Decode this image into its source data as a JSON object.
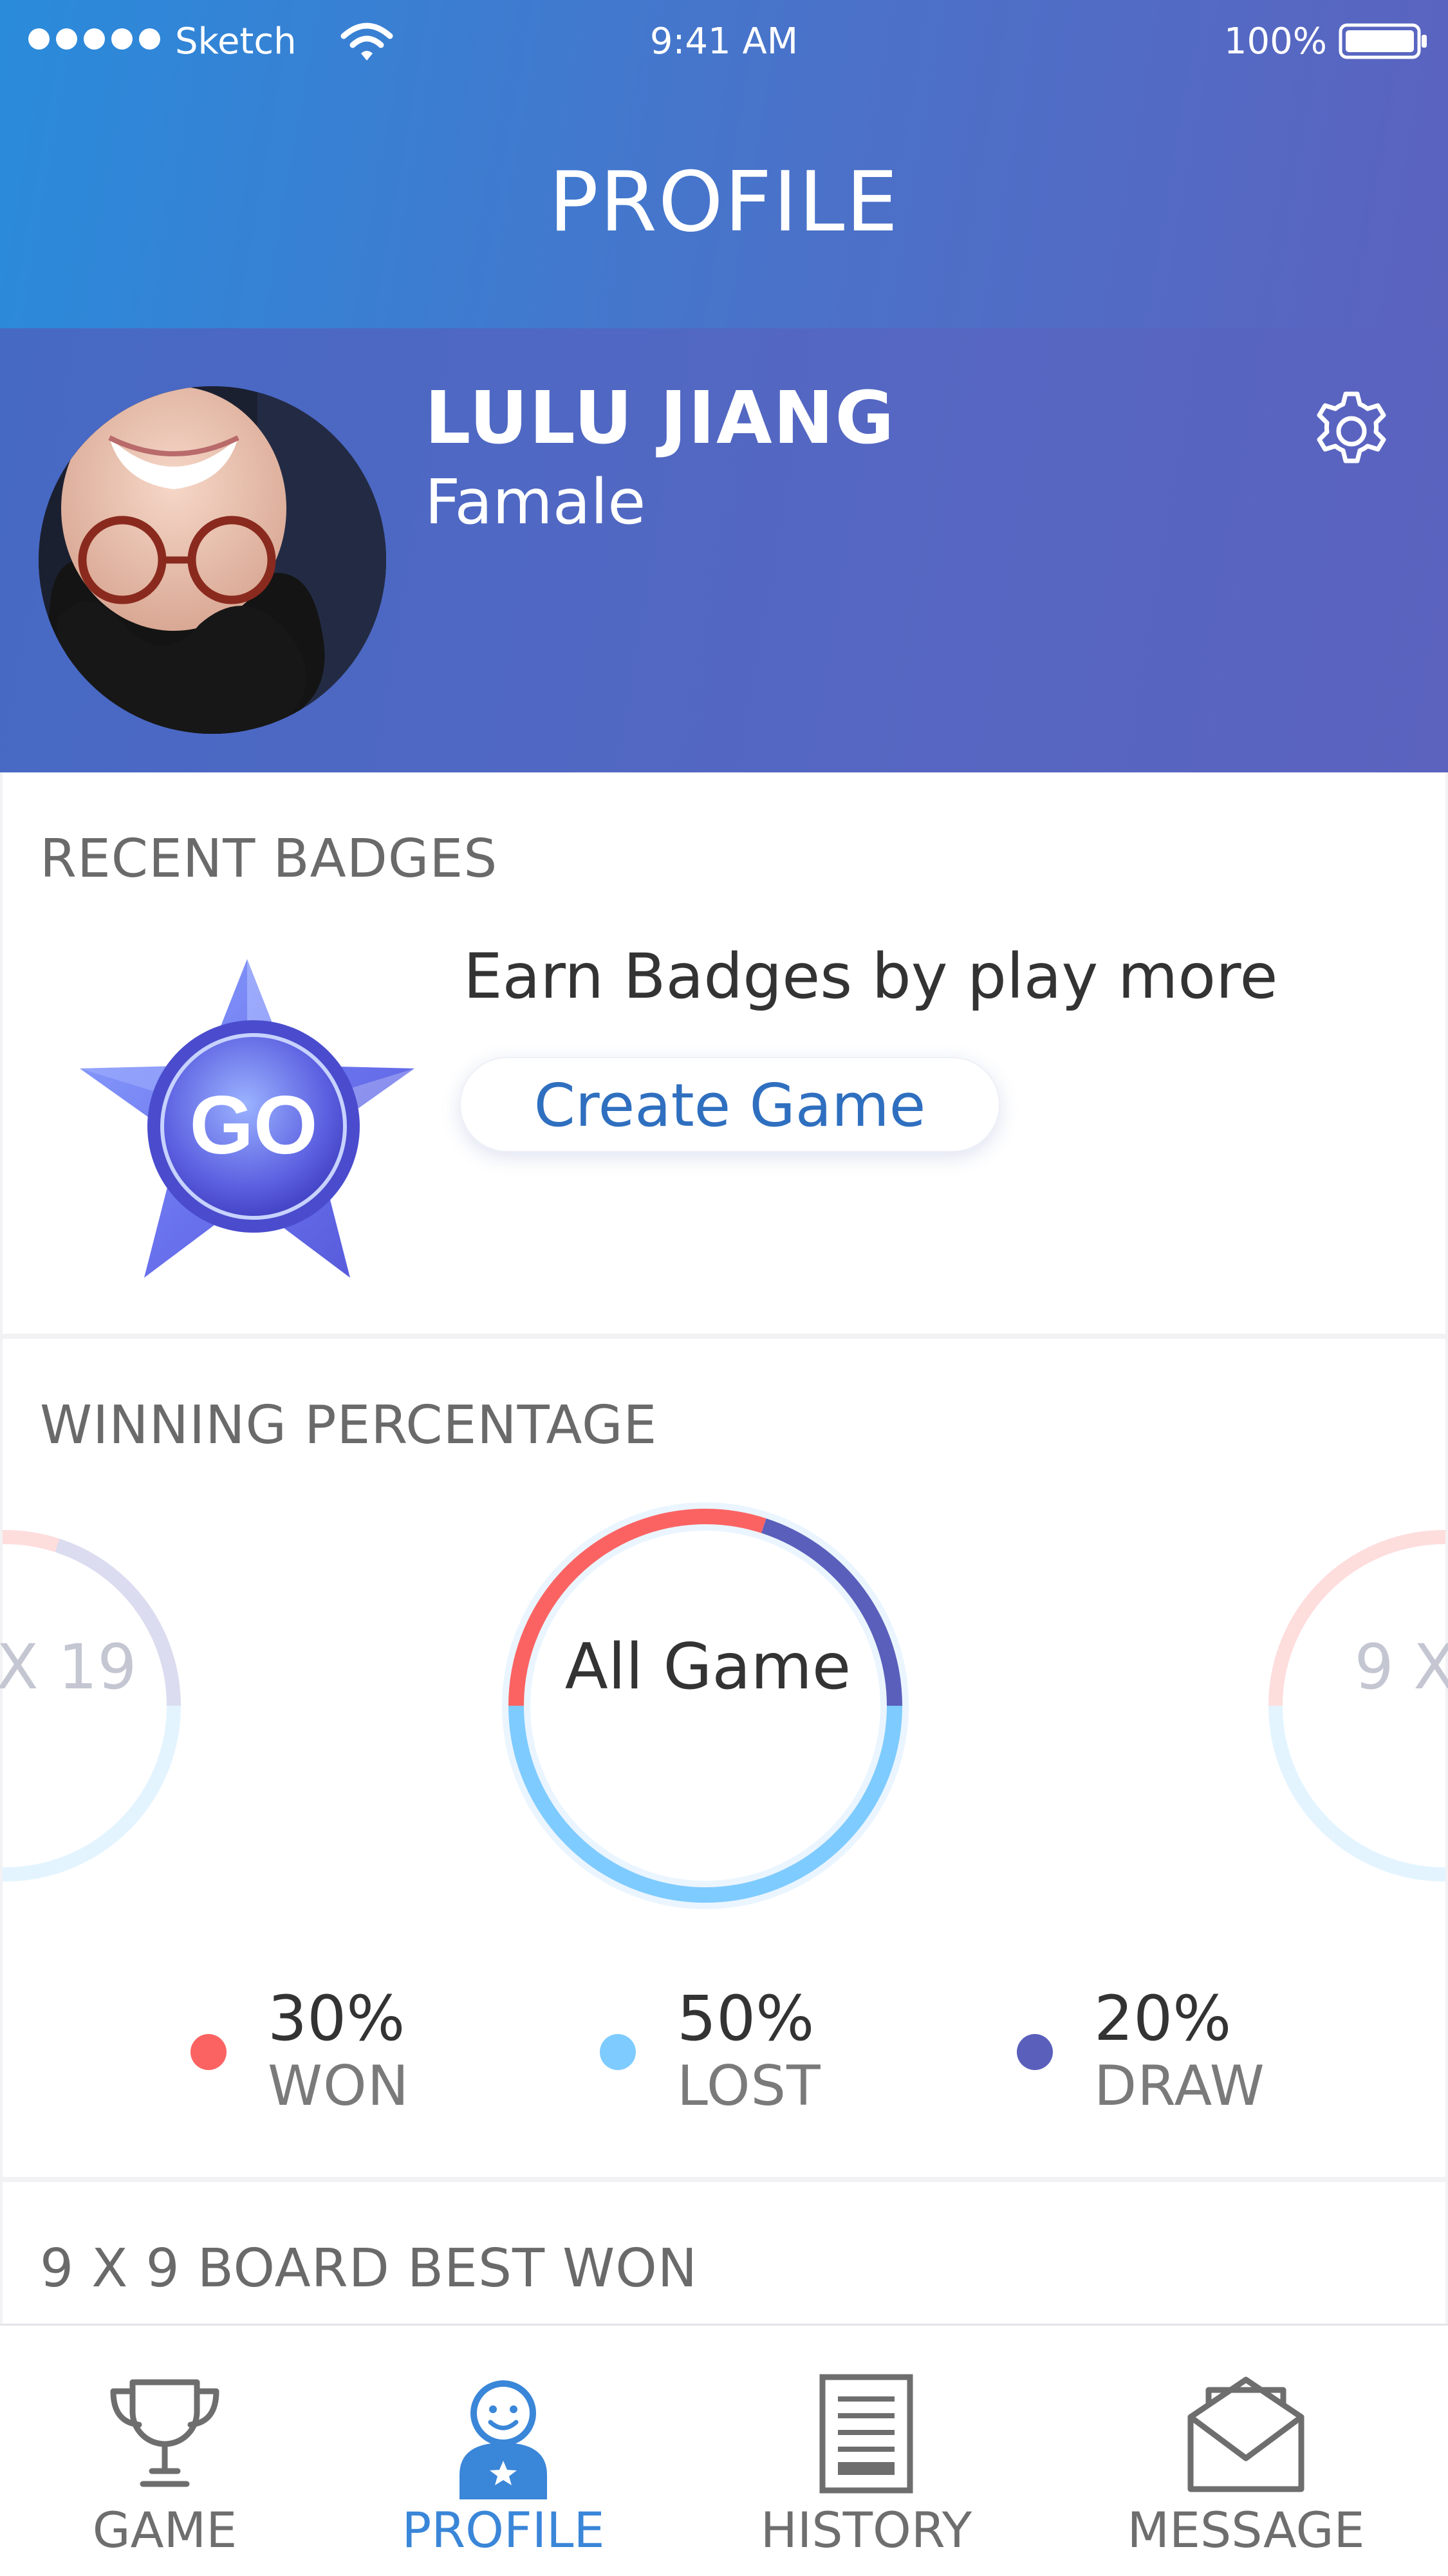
{
  "status_bar": {
    "carrier": "Sketch",
    "time": "9:41 AM",
    "battery": "100%"
  },
  "header": {
    "title": "PROFILE"
  },
  "profile": {
    "name": "LULU JIANG",
    "gender": "Famale"
  },
  "badges": {
    "title": "RECENT BADGES",
    "badge_text": "GO",
    "hint": "Earn Badges by play more",
    "create_label": "Create Game"
  },
  "winning": {
    "title": "WINNING PERCENTAGE",
    "center_label": "All Game",
    "left_label": "X 19",
    "right_label": "9 X",
    "stats": [
      {
        "value": "30%",
        "label": "WON",
        "color": "#fb6363",
        "fraction": 0.3
      },
      {
        "value": "50%",
        "label": "LOST",
        "color": "#7ecbff",
        "fraction": 0.5
      },
      {
        "value": "20%",
        "label": "DRAW",
        "color": "#5a5fbb",
        "fraction": 0.2
      }
    ]
  },
  "best": {
    "title": "9 X 9 BOARD BEST WON"
  },
  "tabs": [
    {
      "label": "GAME",
      "icon": "trophy-icon",
      "active": false
    },
    {
      "label": "PROFILE",
      "icon": "profile-icon",
      "active": true
    },
    {
      "label": "HISTORY",
      "icon": "document-icon",
      "active": false
    },
    {
      "label": "MESSAGE",
      "icon": "envelope-icon",
      "active": false
    }
  ],
  "colors": {
    "header_start": "#2a8bdb",
    "header_end": "#5b63bf",
    "active_tab": "#3a86d8",
    "button_text": "#2f6fbf"
  }
}
